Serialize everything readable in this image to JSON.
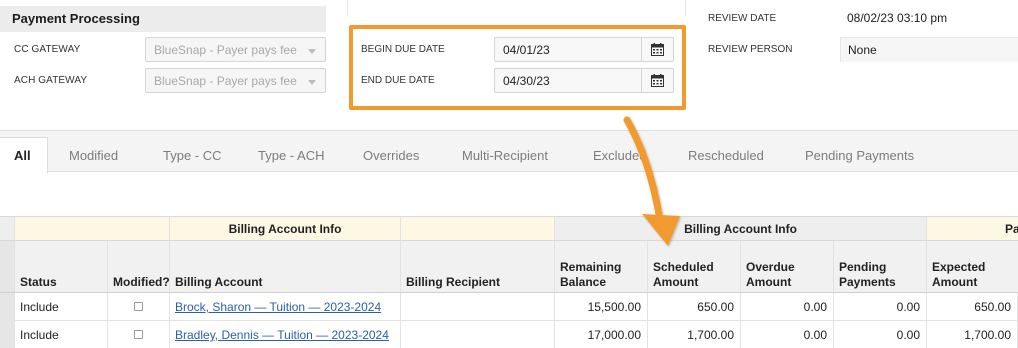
{
  "payment_processing": {
    "title": "Payment Processing",
    "cc_gateway_label": "CC GATEWAY",
    "cc_gateway_value": "BlueSnap - Payer pays fee",
    "ach_gateway_label": "ACH GATEWAY",
    "ach_gateway_value": "BlueSnap - Payer pays fee"
  },
  "due_dates": {
    "begin_label": "BEGIN DUE DATE",
    "begin_value": "04/01/23",
    "end_label": "END DUE DATE",
    "end_value": "04/30/23",
    "calendar_icon": "calendar-icon",
    "highlight_color": "#f29a2e"
  },
  "review": {
    "date_label": "REVIEW DATE",
    "date_value": "08/02/23 03:10 pm",
    "person_label": "REVIEW PERSON",
    "person_value": "None"
  },
  "tabs": [
    {
      "label": "All",
      "active": true
    },
    {
      "label": "Modified"
    },
    {
      "label": "Type - CC"
    },
    {
      "label": "Type - ACH"
    },
    {
      "label": "Overrides"
    },
    {
      "label": "Multi-Recipient"
    },
    {
      "label": "Excluded"
    },
    {
      "label": "Rescheduled"
    },
    {
      "label": "Pending Payments"
    }
  ],
  "grid": {
    "groups": {
      "billing_info_left": "Billing Account Info",
      "billing_info_right": "Billing Account Info",
      "partial": "Pa"
    },
    "columns": {
      "status": "Status",
      "modified": "Modified?",
      "billing_account": "Billing Account",
      "billing_recipient": "Billing Recipient",
      "remaining_balance_1": "Remaining",
      "remaining_balance_2": "Balance",
      "scheduled_amount_1": "Scheduled",
      "scheduled_amount_2": "Amount",
      "overdue_amount_1": "Overdue",
      "overdue_amount_2": "Amount",
      "pending_payments_1": "Pending",
      "pending_payments_2": "Payments",
      "expected_amount_1": "Expected",
      "expected_amount_2": "Amount"
    },
    "rows": [
      {
        "status": "Include",
        "billing_account": "Brock, Sharon — Tuition — 2023-2024",
        "billing_recipient": "",
        "remaining_balance": "15,500.00",
        "scheduled_amount": "650.00",
        "overdue_amount": "0.00",
        "pending_payments": "0.00",
        "expected_amount": "650.00"
      },
      {
        "status": "Include",
        "billing_account": "Bradley, Dennis — Tuition — 2023-2024",
        "billing_recipient": "",
        "remaining_balance": "17,000.00",
        "scheduled_amount": "1,700.00",
        "overdue_amount": "0.00",
        "pending_payments": "0.00",
        "expected_amount": "1,700.00"
      }
    ]
  }
}
